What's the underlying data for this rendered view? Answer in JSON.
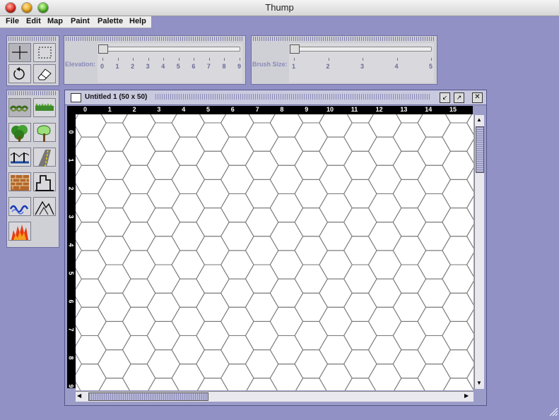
{
  "window": {
    "title": "Thump"
  },
  "menu": [
    "File",
    "Edit",
    "Map",
    "Paint",
    "Palette",
    "Help"
  ],
  "tools": {
    "top": [
      "crosshair-tool-icon",
      "marquee-select-icon",
      "undo-icon",
      "eraser-icon"
    ],
    "terrain": [
      "hedge-icon",
      "grass-icon",
      "forest-icon",
      "trees-icon",
      "bridge-icon",
      "road-icon",
      "brick-wall-icon",
      "building-icon",
      "river-icon",
      "hills-icon",
      "fire-icon"
    ]
  },
  "elevation": {
    "label": "Elevation:",
    "ticks": [
      "0",
      "1",
      "2",
      "3",
      "4",
      "5",
      "6",
      "7",
      "8",
      "9"
    ],
    "value": 0
  },
  "brush": {
    "label": "Brush Size:",
    "ticks": [
      "1",
      "2",
      "3",
      "4",
      "5"
    ],
    "value": 1
  },
  "document": {
    "title": "Untitled 1 (50 x 50)",
    "columns": [
      "0",
      "1",
      "2",
      "3",
      "4",
      "5",
      "6",
      "7",
      "8",
      "9",
      "10",
      "11",
      "12",
      "13",
      "14",
      "15"
    ],
    "rows": [
      "0",
      "1",
      "2",
      "3",
      "4",
      "5",
      "6",
      "7",
      "8",
      "9"
    ]
  },
  "colors": {
    "desktop": "#9191c6",
    "accent": "#6c6ca0"
  }
}
